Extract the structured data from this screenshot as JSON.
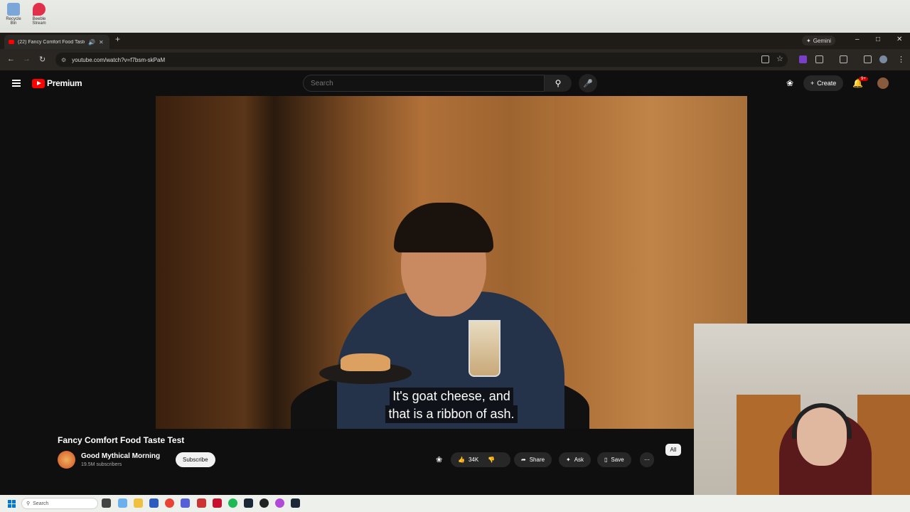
{
  "desktop": {
    "icons": [
      {
        "name": "recycle-bin-icon",
        "label": "Recycle Bin"
      },
      {
        "name": "beeble-stream-icon",
        "label": "Beeble Stream"
      }
    ]
  },
  "browser": {
    "tab_title": "(22) Fancy Comfort Food Taste Test",
    "url": "youtube.com/watch?v=f7bsm-skPaM",
    "gemini_label": "Gemini"
  },
  "youtube": {
    "logo_text": "Premium",
    "search_placeholder": "Search",
    "create_label": "Create",
    "notification_badge": "9+",
    "caption_line1": "It's goat cheese, and",
    "caption_line2": "that is a ribbon of ash.",
    "video_title": "Fancy Comfort Food Taste Test",
    "channel_name": "Good Mythical Morning",
    "channel_subscribers": "19.5M subscribers",
    "subscribe_label": "Subscribe",
    "like_count": "34K",
    "share_label": "Share",
    "ask_label": "Ask",
    "save_label": "Save",
    "chip_all": "All"
  },
  "taskbar": {
    "search_placeholder": "Search"
  },
  "colors": {
    "youtube_red": "#ff0000",
    "page_bg": "#0f0f0f",
    "chip_bg": "#272727"
  }
}
